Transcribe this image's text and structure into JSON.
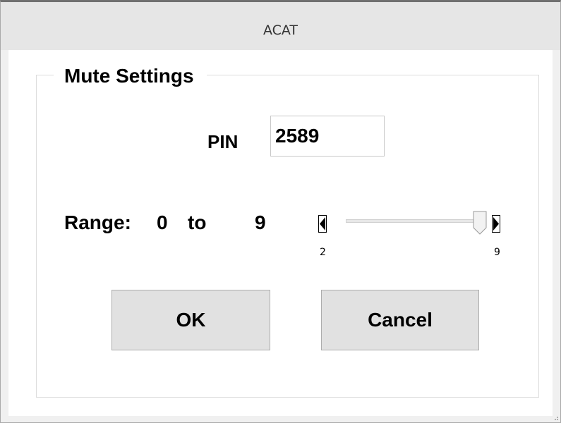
{
  "window": {
    "title": "ACAT"
  },
  "group": {
    "title": "Mute Settings"
  },
  "pin": {
    "label": "PIN",
    "value": "2589"
  },
  "range": {
    "label": "Range:",
    "from": "0",
    "to_label": "to",
    "max": "9"
  },
  "slider": {
    "min_tick": "2",
    "max_tick": "9",
    "min": 2,
    "max": 9,
    "value": 9
  },
  "buttons": {
    "ok_label": "OK",
    "cancel_label": "Cancel"
  },
  "icons": {
    "slider_min_marker": "left-triangle-marker-icon",
    "slider_max_marker": "right-triangle-marker-icon",
    "slider_thumb": "slider-thumb-icon",
    "resize_grip": "resize-grip-icon"
  }
}
